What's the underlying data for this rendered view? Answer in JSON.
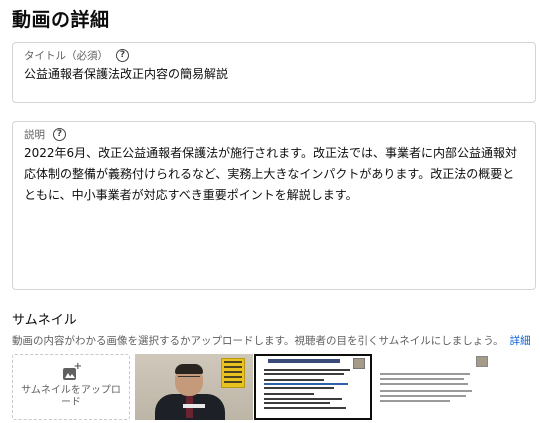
{
  "page": {
    "title": "動画の詳細"
  },
  "title_field": {
    "label": "タイトル（必須）",
    "help_icon": "question-circle-icon",
    "value": "公益通報者保護法改正内容の簡易解説"
  },
  "description_field": {
    "label": "説明",
    "help_icon": "question-circle-icon",
    "value": "2022年6月、改正公益通報者保護法が施行されます。改正法では、事業者に内部公益通報対応体制の整備が義務付けられるなど、実務上大きなインパクトがあります。改正法の概要とともに、中小事業者が対応すべき重要ポイントを解説します。"
  },
  "thumbnail_section": {
    "heading": "サムネイル",
    "description": "動画の内容がわかる画像を選択するかアップロードします。視聴者の目を引くサムネイルにしましょう。",
    "learn_more": "詳細",
    "upload_label": "サムネイルをアップロード",
    "upload_icon": "add-photo-icon",
    "selected_index": 1
  },
  "colors": {
    "link": "#065fd4",
    "secondary_text": "#606060",
    "border": "#d4d4d4",
    "selected_border": "#0d0d0d"
  }
}
